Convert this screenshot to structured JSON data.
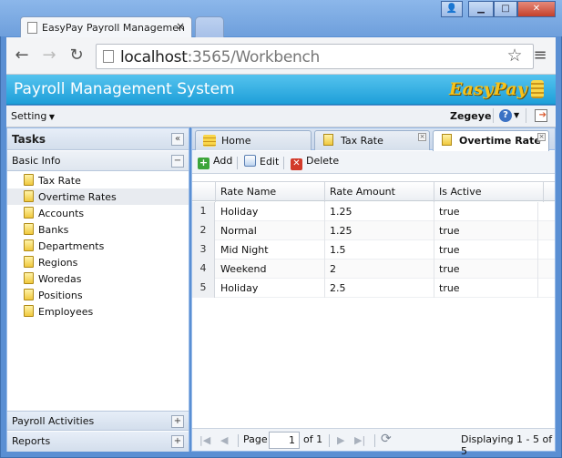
{
  "browser": {
    "tab_title": "EasyPay Payroll Managemen",
    "tab_close": "×",
    "url_host": "localhost",
    "url_rest": ":3565/Workbench",
    "window_controls": {
      "user": "👤",
      "minimize": "▁",
      "maximize": "□",
      "close": "✕"
    },
    "nav_icons": [
      "back-arrow-icon",
      "forward-arrow-icon",
      "reload-icon",
      "star-icon",
      "menu-icon"
    ]
  },
  "app": {
    "title": "Payroll Management System",
    "logo_text": "EasyPay",
    "setting_menu": "Setting",
    "user": "Zegeye",
    "colors": {
      "banner": "#1e9fd9",
      "logo": "#f7c21a"
    }
  },
  "left_panel": {
    "title": "Tasks",
    "collapse": "«",
    "basic_info": "Basic Info",
    "basic_toggle": "−",
    "items": [
      {
        "label": "Tax Rate"
      },
      {
        "label": "Overtime Rates"
      },
      {
        "label": "Accounts"
      },
      {
        "label": "Banks"
      },
      {
        "label": "Departments"
      },
      {
        "label": "Regions"
      },
      {
        "label": "Woredas"
      },
      {
        "label": "Positions"
      },
      {
        "label": "Employees"
      }
    ],
    "payroll_activities": "Payroll Activities",
    "reports": "Reports",
    "expand": "+"
  },
  "tabs": [
    {
      "label": "Home"
    },
    {
      "label": "Tax Rate"
    },
    {
      "label": "Overtime Rate"
    }
  ],
  "grid_toolbar": {
    "add": "Add",
    "edit": "Edit",
    "delete": "Delete"
  },
  "grid": {
    "columns": [
      "Rate Name",
      "Rate Amount",
      "Is Active"
    ],
    "rows": [
      {
        "num": "1",
        "name": "Holiday",
        "amount": "1.25",
        "active": "true"
      },
      {
        "num": "2",
        "name": "Normal",
        "amount": "1.25",
        "active": "true"
      },
      {
        "num": "3",
        "name": "Mid Night",
        "amount": "1.5",
        "active": "true"
      },
      {
        "num": "4",
        "name": "Weekend",
        "amount": "2",
        "active": "true"
      },
      {
        "num": "5",
        "name": "Holiday",
        "amount": "2.5",
        "active": "true"
      }
    ]
  },
  "paging": {
    "page_label": "Page",
    "page_value": "1",
    "of": "of 1",
    "status": "Displaying 1 - 5 of 5"
  }
}
